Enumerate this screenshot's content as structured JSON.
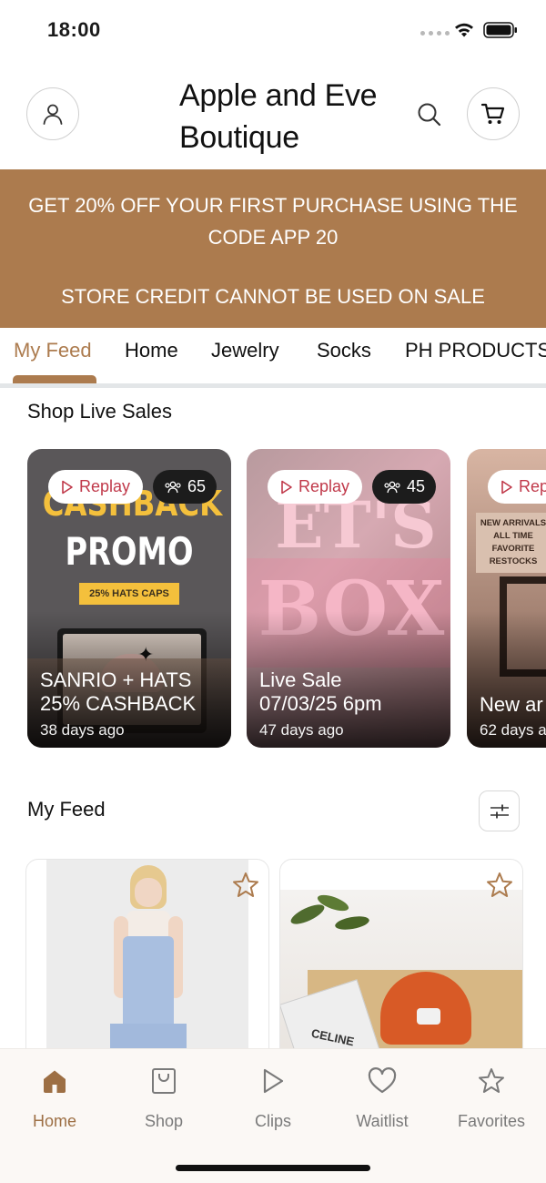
{
  "status": {
    "time": "18:00"
  },
  "header": {
    "title": "Apple and Eve Boutique"
  },
  "banner": {
    "promo": "GET 20% OFF YOUR FIRST PURCHASE USING THE CODE APP 20",
    "note": "STORE CREDIT CANNOT BE USED ON SALE"
  },
  "tabs": [
    {
      "label": "My Feed",
      "active": true
    },
    {
      "label": "Home"
    },
    {
      "label": "Jewelry"
    },
    {
      "label": "Socks"
    },
    {
      "label": "PH PRODUCTS"
    }
  ],
  "live": {
    "title": "Shop Live Sales",
    "cards": [
      {
        "replay": "Replay",
        "viewers": "65",
        "poster_top": "CASHBACK",
        "poster_big": "PROMO",
        "poster_tag": "25% HATS CAPS",
        "title_line1": "SANRIO + HATS",
        "title_line2": "25% CASHBACK",
        "age": "38 days ago"
      },
      {
        "replay": "Replay",
        "viewers": "45",
        "poster_top": "ET'S",
        "poster_big": "BOX",
        "title_line1": "Live Sale",
        "title_line2": "07/03/25 6pm",
        "age": "47 days ago"
      },
      {
        "replay": "Rep",
        "poster_lines": [
          "NEW ARRIVALS",
          "ALL TIME",
          "FAVORITE",
          "RESTOCKS"
        ],
        "title_line1": "New ar",
        "age": "62 days a"
      }
    ]
  },
  "feed": {
    "title": "My Feed",
    "products": [
      {
        "image": "model-in-blue-overalls"
      },
      {
        "image": "orange-cap-with-celine-magazine",
        "brand_print": "CELINE"
      }
    ]
  },
  "tabbar": [
    {
      "label": "Home",
      "icon": "home-icon",
      "active": true
    },
    {
      "label": "Shop",
      "icon": "shop-bag-icon"
    },
    {
      "label": "Clips",
      "icon": "play-icon"
    },
    {
      "label": "Waitlist",
      "icon": "heart-icon"
    },
    {
      "label": "Favorites",
      "icon": "star-icon"
    }
  ],
  "colors": {
    "brand": "#ac7b4e",
    "active_tab": "#9d6f44",
    "replay_text": "#c0394a"
  }
}
